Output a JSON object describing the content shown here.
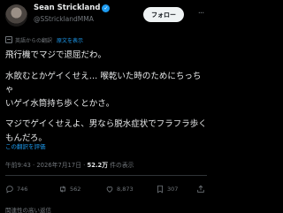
{
  "author": {
    "display_name": "Sean Strickland",
    "handle": "@SStricklandMMA",
    "verified_mark": "✓"
  },
  "follow_label": "フォロー",
  "more_glyph": "···",
  "translation": {
    "note": "英語からの翻訳",
    "show_original": "原文を表示"
  },
  "tweet": {
    "line1": "飛行機でマジで退屈だわ。",
    "line2a": "水飲むとかゲイくせえ… 喉乾いた時のためにちっちゃ",
    "line2b": "いゲイ水筒持ち歩くとかさ。",
    "line3a": "マジでゲイくせえよ、男なら脱水症状でフラフラ歩く",
    "line3b": "もんだろ。"
  },
  "rate_translation": "この翻訳を評価",
  "meta": {
    "time": "午前9:43",
    "separator": " · ",
    "date": "2026年7月17日",
    "views": "52.2万",
    "views_label": " 件の表示"
  },
  "actions": {
    "reply_count": "746",
    "retweet_count": "562",
    "like_count": "8,873",
    "bookmark_count": "307"
  },
  "footer": "関連性の高い返信",
  "colors": {
    "background": "#000000",
    "text": "#e7e9ea",
    "muted": "#71767b",
    "accent": "#1d9bf0"
  }
}
